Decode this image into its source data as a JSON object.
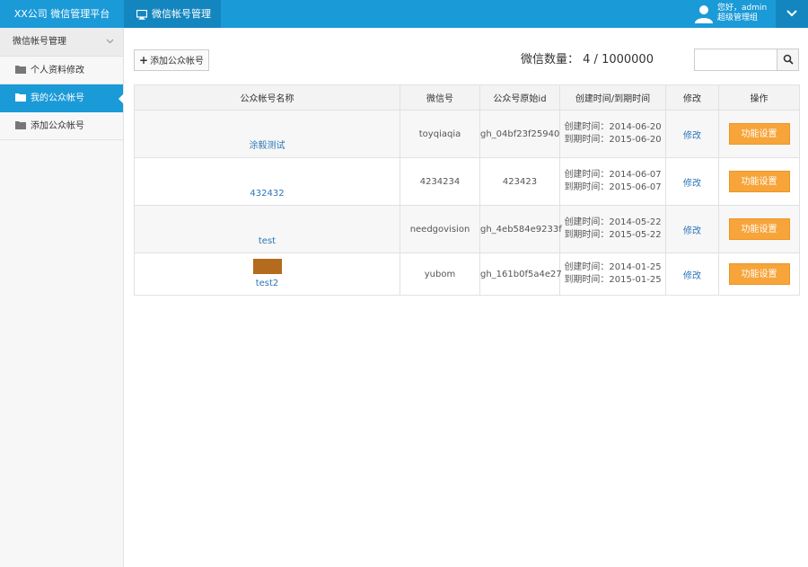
{
  "app": {
    "brand": "XX公司  微信管理平台",
    "active_module": "微信帐号管理"
  },
  "user": {
    "greeting": "您好，admin",
    "role": "超级管理组"
  },
  "sidebar": {
    "header": "微信帐号管理",
    "items": [
      {
        "label": "个人资料修改",
        "icon": "folder-icon",
        "active": false
      },
      {
        "label": "我的公众帐号",
        "icon": "folder-icon",
        "active": true
      },
      {
        "label": "添加公众帐号",
        "icon": "folder-icon",
        "active": false
      }
    ]
  },
  "toolbar": {
    "add_label": "添加公众帐号",
    "count_label": "微信数量：",
    "count_value": "4 / 1000000",
    "search_placeholder": ""
  },
  "table": {
    "headers": [
      "公众帐号名称",
      "微信号",
      "公众号原始id",
      "创建时间/到期时间",
      "修改",
      "操作"
    ],
    "rows": [
      {
        "name": "涂毅测试",
        "wechat": "toyqiaqia",
        "raw_id": "gh_04bf23f25940",
        "created": "创建时间：2014-06-20",
        "expires": "到期时间：2015-06-20",
        "edit": "修改",
        "action": "功能设置"
      },
      {
        "name": "432432",
        "wechat": "4234234",
        "raw_id": "423423",
        "created": "创建时间：2014-06-07",
        "expires": "到期时间：2015-06-07",
        "edit": "修改",
        "action": "功能设置"
      },
      {
        "name": "test",
        "wechat": "needgovision",
        "raw_id": "gh_4eb584e9233f",
        "created": "创建时间：2014-05-22",
        "expires": "到期时间：2015-05-22",
        "edit": "修改",
        "action": "功能设置"
      },
      {
        "name": "test2",
        "wechat": "yubom",
        "raw_id": "gh_161b0f5a4e27",
        "created": "创建时间：2014-01-25",
        "expires": "到期时间：2015-01-25",
        "edit": "修改",
        "action": "功能设置"
      }
    ]
  },
  "colors": {
    "primary": "#1b9ad8",
    "primary_dark": "#1486bf",
    "action": "#f7a43a",
    "link": "#2a76b8"
  }
}
